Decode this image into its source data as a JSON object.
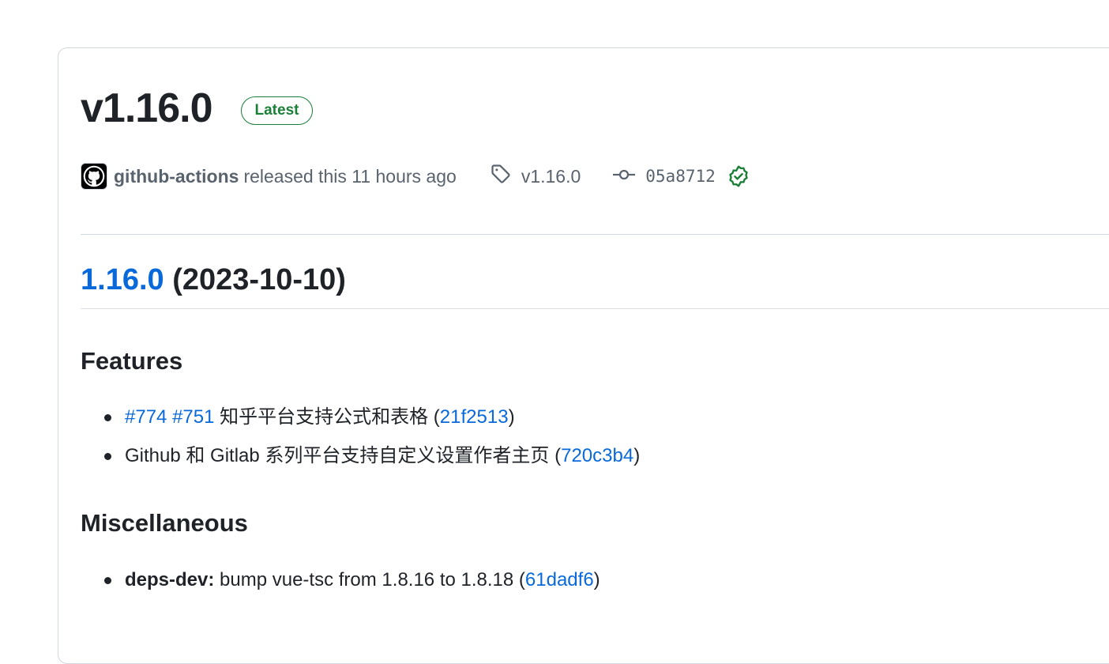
{
  "release": {
    "title": "v1.16.0",
    "badge": "Latest",
    "author": "github-actions",
    "released_text": "released this 11 hours ago",
    "tag": "v1.16.0",
    "commit": "05a8712"
  },
  "body": {
    "version_link": "1.16.0",
    "version_date": "(2023-10-10)",
    "features": {
      "heading": "Features",
      "items": [
        {
          "refs": [
            "#774",
            "#751"
          ],
          "text": "知乎平台支持公式和表格",
          "paren_open": "(",
          "commit": "21f2513",
          "paren_close": ")"
        },
        {
          "text": "Github 和 Gitlab 系列平台支持自定义设置作者主页",
          "paren_open": "(",
          "commit": "720c3b4",
          "paren_close": ")"
        }
      ]
    },
    "misc": {
      "heading": "Miscellaneous",
      "items": [
        {
          "scope": "deps-dev:",
          "text": "bump vue-tsc from 1.8.16 to 1.8.18",
          "paren_open": "(",
          "commit": "61dadf6",
          "paren_close": ")"
        }
      ]
    }
  },
  "icons": {
    "avatar": "github-mark-icon",
    "tag": "tag-icon",
    "commit": "git-commit-icon",
    "verified": "verified-check-icon"
  },
  "colors": {
    "link": "#0969da",
    "badge_green": "#1a7f37",
    "muted": "#59636e",
    "border": "#d0d7de"
  }
}
